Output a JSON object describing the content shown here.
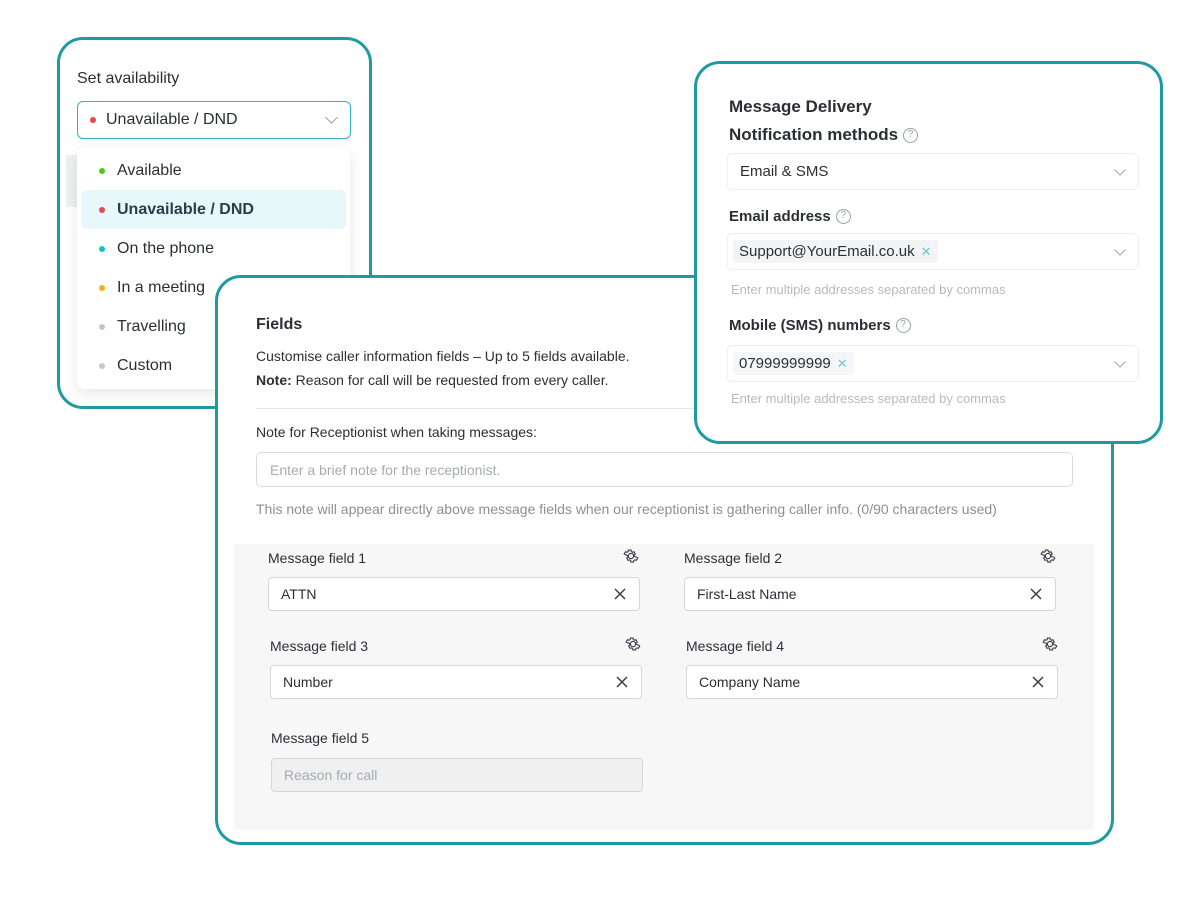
{
  "availability": {
    "title": "Set availability",
    "selected": {
      "label": "Unavailable / DND",
      "color": "#e5484d"
    },
    "options": [
      {
        "label": "Available",
        "color": "#52c41a"
      },
      {
        "label": "Unavailable / DND",
        "color": "#e5484d"
      },
      {
        "label": "On the phone",
        "color": "#13c2c2"
      },
      {
        "label": "In a meeting",
        "color": "#faad14"
      },
      {
        "label": "Travelling",
        "color": "#c4c7ca"
      },
      {
        "label": "Custom",
        "color": "#c4c7ca"
      }
    ]
  },
  "fields": {
    "title": "Fields",
    "description": "Customise caller information fields – Up to 5 fields available.",
    "note_bold": "Note:",
    "note_text": " Reason for call will be requested from every caller.",
    "receptionist_note_label": "Note for Receptionist when taking messages:",
    "receptionist_note_placeholder": "Enter a brief note for the receptionist.",
    "receptionist_note_value": "",
    "help_text": "This note will appear directly above message fields when our receptionist is gathering caller info. (0/90 characters used)",
    "message_fields": [
      {
        "label": "Message field 1",
        "value": "ATTN"
      },
      {
        "label": "Message field 2",
        "value": "First-Last Name"
      },
      {
        "label": "Message field 3",
        "value": "Number"
      },
      {
        "label": "Message field 4",
        "value": "Company Name"
      },
      {
        "label": "Message field 5",
        "value": "Reason for call",
        "disabled": true
      }
    ]
  },
  "message_delivery": {
    "title": "Message Delivery",
    "methods_label": "Notification methods",
    "methods_value": "Email & SMS",
    "email_label": "Email address",
    "email_tags": [
      "Support@YourEmail.co.uk"
    ],
    "email_help": "Enter multiple addresses separated by commas",
    "sms_label": "Mobile (SMS) numbers",
    "sms_tags": [
      "07999999999"
    ],
    "sms_help": "Enter multiple addresses separated by commas"
  },
  "colors": {
    "accent": "#1e9aa0",
    "focus": "#31b3c4",
    "selected_bg": "#e7f7fa"
  }
}
